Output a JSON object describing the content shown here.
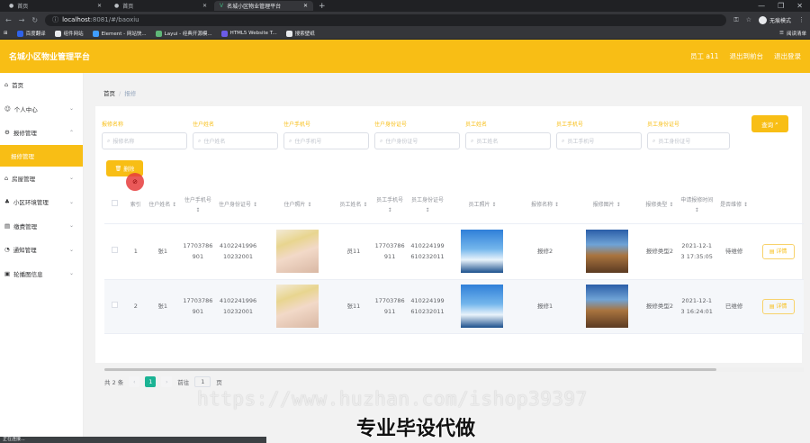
{
  "browser": {
    "tabs": [
      {
        "label": "首页",
        "active": false
      },
      {
        "label": "首页",
        "active": false
      },
      {
        "label": "名城小区物业管理平台",
        "active": true
      }
    ],
    "url_host": "localhost",
    "url_rest": ":8081/#/baoxiu",
    "profile": "无痕模式",
    "bookmarks": [
      "百度翻译",
      "组件网站",
      "Element - 网站快...",
      "Layui - 经典开源模...",
      "HTML5 Website T...",
      "搜索壁纸"
    ],
    "bookmarks_right": "阅读清单"
  },
  "header": {
    "title": "名城小区物业管理平台",
    "user": "员工 a11",
    "back_link": "退出到前台",
    "logout": "退出登录"
  },
  "sidebar": {
    "items": [
      {
        "label": "首页",
        "icon": "home-icon",
        "arrow": false
      },
      {
        "label": "个人中心",
        "icon": "user-icon",
        "arrow": true
      },
      {
        "label": "报修管理",
        "icon": "tool-icon",
        "arrow": true
      },
      {
        "label": "报修管理",
        "icon": "",
        "arrow": false,
        "active": true
      },
      {
        "label": "房屋管理",
        "icon": "house-icon",
        "arrow": true
      },
      {
        "label": "小区环境管理",
        "icon": "tree-icon",
        "arrow": true
      },
      {
        "label": "缴费管理",
        "icon": "wallet-icon",
        "arrow": true
      },
      {
        "label": "通知管理",
        "icon": "bell-icon",
        "arrow": true
      },
      {
        "label": "轮播图信息",
        "icon": "image-icon",
        "arrow": true
      }
    ]
  },
  "breadcrumb": {
    "home": "首页",
    "current": "报修"
  },
  "filters": {
    "labels": [
      "报修名称",
      "住户姓名",
      "住户手机号",
      "住户身份证号",
      "员工姓名",
      "员工手机号",
      "员工身份证号"
    ],
    "placeholders": [
      "报修名称",
      "住户姓名",
      "住户手机号",
      "住户身份证号",
      "员工姓名",
      "员工手机号",
      "员工身份证号"
    ],
    "query_button": "查询"
  },
  "actions": {
    "delete_button": "删除"
  },
  "table": {
    "headers": [
      "",
      "索引",
      "住户姓名",
      "住户手机号",
      "住户身份证号",
      "住户照片",
      "员工姓名",
      "员工手机号",
      "员工身份证号",
      "员工照片",
      "报修名称",
      "报修图片",
      "报修类型",
      "申请报修时间",
      "是否维修",
      ""
    ],
    "rows": [
      {
        "index": "1",
        "resident_name": "张1",
        "resident_phone": "17703786901",
        "resident_id": "410224199610232001",
        "staff_name": "员11",
        "staff_phone": "17703786911",
        "staff_id": "410224199610232011",
        "repair_name": "报修2",
        "repair_type": "报修类型2",
        "time": "2021-12-13 17:35:05",
        "status": "待维修",
        "detail": "详情"
      },
      {
        "index": "2",
        "resident_name": "张1",
        "resident_phone": "17703786901",
        "resident_id": "410224199610232001",
        "staff_name": "张11",
        "staff_phone": "17703786911",
        "staff_id": "410224199610232011",
        "repair_name": "报修1",
        "repair_type": "报修类型2",
        "time": "2021-12-13 16:24:01",
        "status": "已维修",
        "detail": "详情"
      }
    ]
  },
  "pagination": {
    "total": "共 2 条",
    "current_page": "1",
    "goto_label": "前往",
    "goto_value": "1",
    "page_suffix": "页"
  },
  "overlay": {
    "watermark": "https://www.huzhan.com/ishop39397",
    "subtitle": "专业毕设代做",
    "statusbar": "正在连接..."
  },
  "colors": {
    "accent": "#f8be15",
    "pager_active": "#1bb394"
  }
}
